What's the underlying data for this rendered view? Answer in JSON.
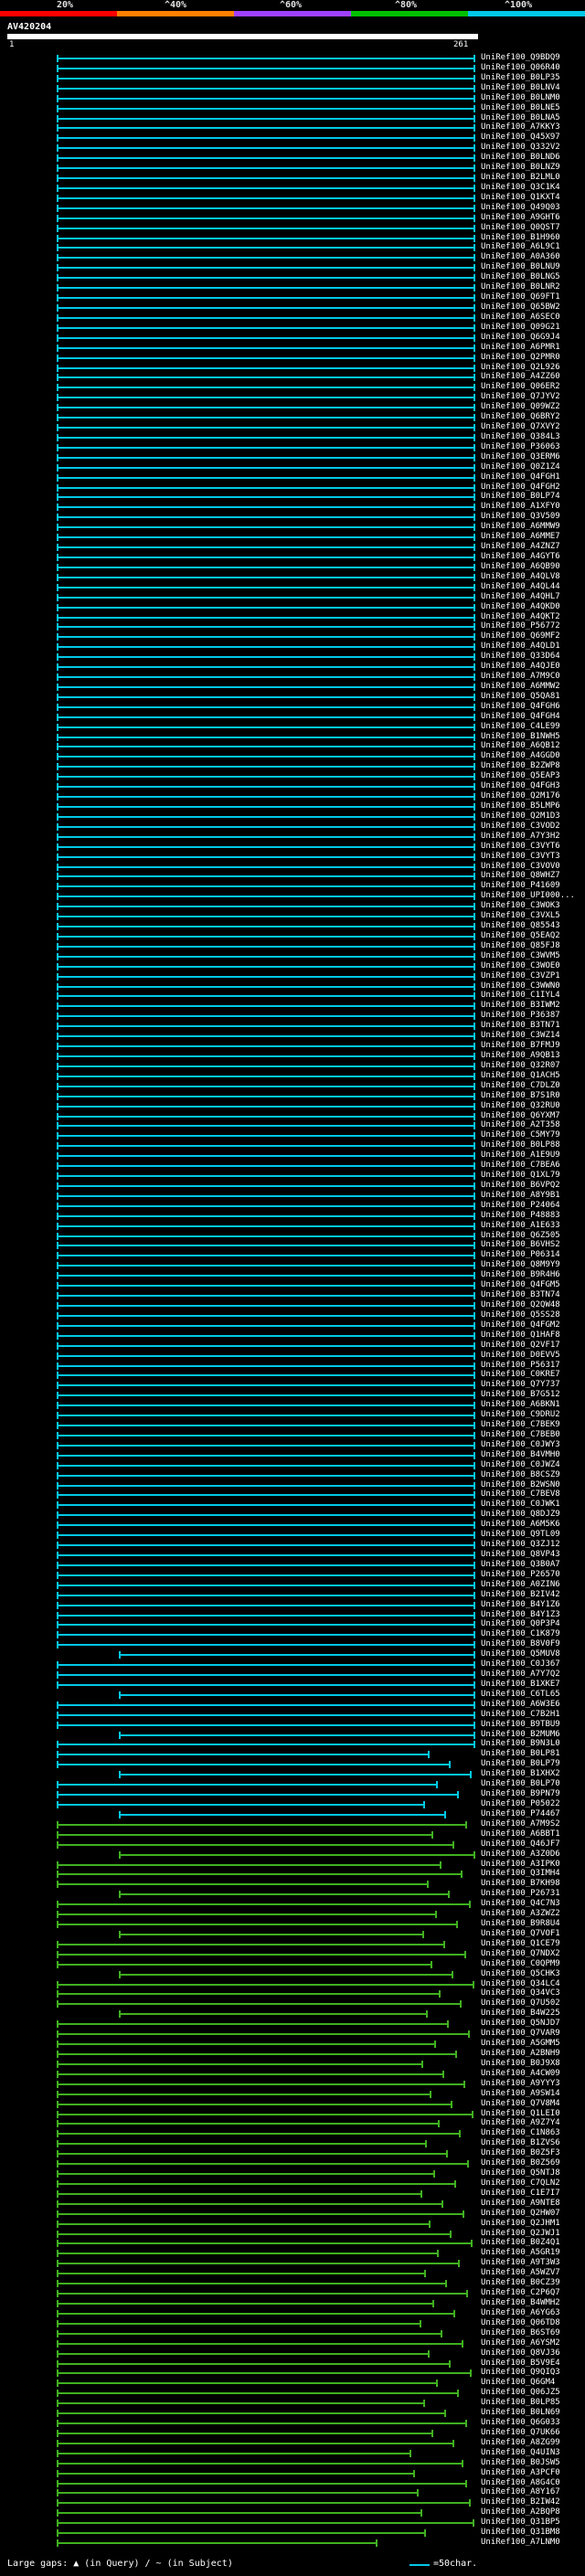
{
  "scale": {
    "labels": [
      "20%",
      "^40%",
      "^60%",
      "^80%",
      "^100%"
    ],
    "colors": [
      "#ff0000",
      "#ff8000",
      "#a040ff",
      "#00c000",
      "#00c8e6"
    ]
  },
  "query": {
    "name": "AV420204",
    "start": "1",
    "end": "261"
  },
  "hit_colors": {
    "cyan": "#00c8e6",
    "green": "#40b020"
  },
  "hits": [
    "UniRef100_Q9BDQ9",
    "UniRef100_Q06R40",
    "UniRef100_B0LP35",
    "UniRef100_B0LNV4",
    "UniRef100_B0LNM0",
    "UniRef100_B0LNE5",
    "UniRef100_B0LNA5",
    "UniRef100_A7KKY3",
    "UniRef100_Q45X97",
    "UniRef100_Q332V2",
    "UniRef100_B0LND6",
    "UniRef100_B0LNZ9",
    "UniRef100_B2LML0",
    "UniRef100_Q3C1K4",
    "UniRef100_Q1KXT4",
    "UniRef100_Q49Q03",
    "UniRef100_A9GHT6",
    "UniRef100_Q0QST7",
    "UniRef100_B1H960",
    "UniRef100_A6L9C1",
    "UniRef100_A0A360",
    "UniRef100_B0LNU9",
    "UniRef100_B0LNG5",
    "UniRef100_B0LNR2",
    "UniRef100_Q69FT1",
    "UniRef100_Q65BW2",
    "UniRef100_A6SEC0",
    "UniRef100_Q09G21",
    "UniRef100_Q6G9J4",
    "UniRef100_A6PMR1",
    "UniRef100_Q2PMR0",
    "UniRef100_Q2L926",
    "UniRef100_A4ZZ60",
    "UniRef100_Q06ER2",
    "UniRef100_Q7JYV2",
    "UniRef100_Q09WZ2",
    "UniRef100_Q6BRY2",
    "UniRef100_Q7XVY2",
    "UniRef100_Q384L3",
    "UniRef100_P36063",
    "UniRef100_Q3ERM6",
    "UniRef100_Q0Z1Z4",
    "UniRef100_Q4FGH1",
    "UniRef100_Q4FGH2",
    "UniRef100_B0LP74",
    "UniRef100_A1XFY0",
    "UniRef100_Q3V509",
    "UniRef100_A6MMW9",
    "UniRef100_A6MME7",
    "UniRef100_A4ZNZ7",
    "UniRef100_A4GYT6",
    "UniRef100_A6QB90",
    "UniRef100_A4QLV8",
    "UniRef100_A4QL44",
    "UniRef100_A4QHL7",
    "UniRef100_A4QKD0",
    "UniRef100_A4QKT2",
    "UniRef100_P56772",
    "UniRef100_Q69MF2",
    "UniRef100_A4QLD1",
    "UniRef100_Q33D64",
    "UniRef100_A4QJE0",
    "UniRef100_A7M9C0",
    "UniRef100_A6MMW2",
    "UniRef100_Q5QA81",
    "UniRef100_Q4FGH6",
    "UniRef100_Q4FGH4",
    "UniRef100_C4LE99",
    "UniRef100_B1NWH5",
    "UniRef100_A6QB12",
    "UniRef100_A4GGD0",
    "UniRef100_B2ZWP8",
    "UniRef100_Q5EAP3",
    "UniRef100_Q4FGH3",
    "UniRef100_Q2M176",
    "UniRef100_B5LMP6",
    "UniRef100_Q2M1D3",
    "UniRef100_C3VOD2",
    "UniRef100_A7Y3H2",
    "UniRef100_C3VYT6",
    "UniRef100_C3VYT3",
    "UniRef100_C3VOV0",
    "UniRef100_Q8WHZ7",
    "UniRef100_P41609",
    "UniRef100_UPI000...",
    "UniRef100_C3WOK3",
    "UniRef100_C3VXL5",
    "UniRef100_Q85543",
    "UniRef100_Q5EAQ2",
    "UniRef100_Q85FJ8",
    "UniRef100_C3WVM5",
    "UniRef100_C3WOE0",
    "UniRef100_C3VZP1",
    "UniRef100_C3WWN0",
    "UniRef100_C1IYL4",
    "UniRef100_B3IWM2",
    "UniRef100_P36387",
    "UniRef100_B3TN71",
    "UniRef100_C3WZ14",
    "UniRef100_B7FMJ9",
    "UniRef100_A9QB13",
    "UniRef100_Q32R07",
    "UniRef100_Q1ACH5",
    "UniRef100_C7DLZ0",
    "UniRef100_B7S1R0",
    "UniRef100_Q32RU0",
    "UniRef100_Q6YXM7",
    "UniRef100_A2T358",
    "UniRef100_C5MY79",
    "UniRef100_B0LP88",
    "UniRef100_A1E9U9",
    "UniRef100_C7BEA6",
    "UniRef100_Q1XL79",
    "UniRef100_B6VPQ2",
    "UniRef100_A8Y9B1",
    "UniRef100_P24064",
    "UniRef100_P48883",
    "UniRef100_A1E633",
    "UniRef100_Q6Z505",
    "UniRef100_B6VHS2",
    "UniRef100_P06314",
    "UniRef100_Q8M9Y9",
    "UniRef100_B9R4H6",
    "UniRef100_Q4FGM5",
    "UniRef100_B3TN74",
    "UniRef100_Q2QW48",
    "UniRef100_Q5SS28",
    "UniRef100_Q4FGM2",
    "UniRef100_Q1HAF8",
    "UniRef100_Q2VF17",
    "UniRef100_D0EVV5",
    "UniRef100_P56317",
    "UniRef100_C0KRE7",
    "UniRef100_Q7Y737",
    "UniRef100_B7G512",
    "UniRef100_A6BKN1",
    "UniRef100_C9DRU2",
    "UniRef100_C7BEK9",
    "UniRef100_C7BEB0",
    "UniRef100_C0JWY3",
    "UniRef100_B4VMH0",
    "UniRef100_C0JWZ4",
    "UniRef100_B8CSZ9",
    "UniRef100_B2WSN0",
    "UniRef100_C7BEV8",
    "UniRef100_C0JWK1",
    "UniRef100_Q8DJZ9",
    "UniRef100_A6M5K6",
    "UniRef100_Q9TL09",
    "UniRef100_Q3ZJ12",
    "UniRef100_Q8VP43",
    "UniRef100_Q3B0A7",
    "UniRef100_P26570",
    "UniRef100_A0ZIN6",
    "UniRef100_B2IV42",
    "UniRef100_B4Y1Z6",
    "UniRef100_B4Y1Z3",
    "UniRef100_Q0P3P4",
    "UniRef100_C1K879",
    "UniRef100_B8V0F9",
    "UniRef100_Q5MUV8",
    "UniRef100_C0J367",
    "UniRef100_A7Y7Q2",
    "UniRef100_B1XKE7",
    "UniRef100_C6TL65",
    "UniRef100_A6W3E6",
    "UniRef100_C7B2H1",
    "UniRef100_B9TBU9",
    "UniRef100_B2MUM6",
    "UniRef100_B9N3L0",
    "UniRef100_B0LP81",
    "UniRef100_B0LP79",
    "UniRef100_B1XHX2",
    "UniRef100_B0LP70",
    "UniRef100_B9PN79",
    "UniRef100_P05022",
    "UniRef100_P74467",
    "UniRef100_A7M9S2",
    "UniRef100_A6BBT1",
    "UniRef100_Q46JF7",
    "UniRef100_A3Z0D6",
    "UniRef100_A3IPK0",
    "UniRef100_Q3IMH4",
    "UniRef100_B7KH98",
    "UniRef100_P26731",
    "UniRef100_Q4C7N3",
    "UniRef100_A3ZWZ2",
    "UniRef100_B9R8U4",
    "UniRef100_Q7VOF1",
    "UniRef100_Q1CE79",
    "UniRef100_Q7NDX2",
    "UniRef100_C0QPM9",
    "UniRef100_Q5CHK3",
    "UniRef100_Q34LC4",
    "UniRef100_Q34VC3",
    "UniRef100_Q7U502",
    "UniRef100_B4W225",
    "UniRef100_Q5NJD7",
    "UniRef100_Q7VAR9",
    "UniRef100_A5GMM5",
    "UniRef100_A2BNH9",
    "UniRef100_B0J9X8",
    "UniRef100_A4CW09",
    "UniRef100_A9YYY3",
    "UniRef100_A9SW14",
    "UniRef100_Q7V8M4",
    "UniRef100_Q1LEI0",
    "UniRef100_A9Z7Y4",
    "UniRef100_C1N863",
    "UniRef100_B1ZVS6",
    "UniRef100_B0Z5F3",
    "UniRef100_B0Z569",
    "UniRef100_Q5NTJ8",
    "UniRef100_C7QLN2",
    "UniRef100_C1E7I7",
    "UniRef100_A9NTE8",
    "UniRef100_Q2HW07",
    "UniRef100_Q2JHM1",
    "UniRef100_Q2JWJ1",
    "UniRef100_B0Z4Q1",
    "UniRef100_A5GR19",
    "UniRef100_A9T3W3",
    "UniRef100_A5WZV7",
    "UniRef100_B0CZ39",
    "UniRef100_C2P6Q7",
    "UniRef100_B4WMH2",
    "UniRef100_A6YG63",
    "UniRef100_Q06TD8",
    "UniRef100_B6ST69",
    "UniRef100_A6YSM2",
    "UniRef100_Q8VJ36",
    "UniRef100_B5V9E4",
    "UniRef100_Q9QIQ3",
    "UniRef100_Q6GM4",
    "UniRef100_Q06JZ5",
    "UniRef100_B0LP85",
    "UniRef100_B0LN69",
    "UniRef100_Q6G033",
    "UniRef100_Q7UK66",
    "UniRef100_A8ZG99",
    "UniRef100_Q4UIN3",
    "UniRef100_B0JSW5",
    "UniRef100_A3PCF0",
    "UniRef100_A8G4C0",
    "UniRef100_A8Y167",
    "UniRef100_B2IW42",
    "UniRef100_A2BQP8",
    "UniRef100_Q31BP5",
    "UniRef100_Q31BM8",
    "UniRef100_A7LNM0"
  ],
  "footer": {
    "gaps_text": "Large gaps: ▲ (in Query) / ~ (in Subject)",
    "legend_text": "=50char."
  }
}
